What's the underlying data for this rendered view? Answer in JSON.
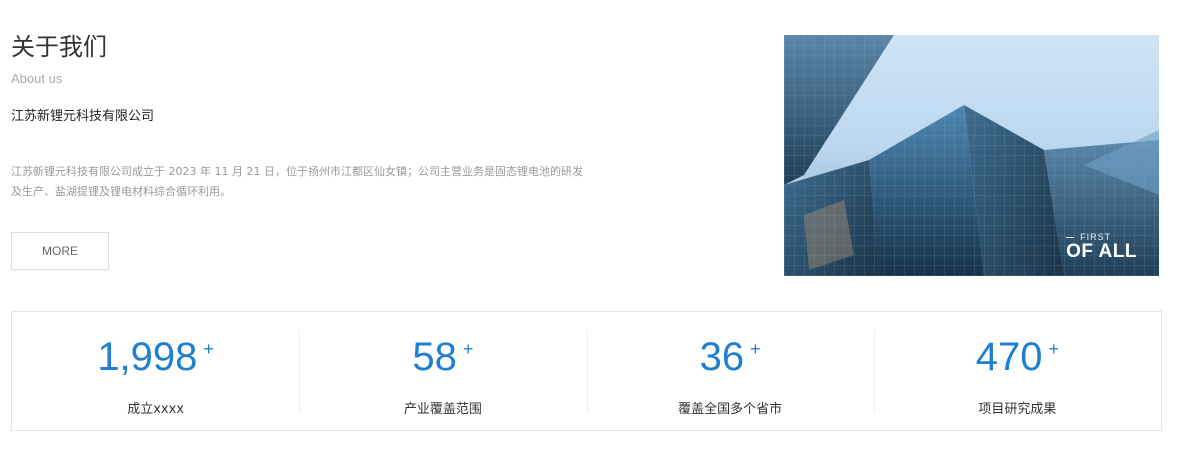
{
  "about": {
    "title": "关于我们",
    "subtitle": "About us",
    "company": "江苏新锂元科技有限公司",
    "description": "江苏新锂元科技有限公司成立于 2023 年 11 月 21 日，位于扬州市江都区仙女镇；公司主营业务是固态锂电池的研发及生产、盐湖提锂及锂电材料综合循环利用。",
    "more_label": "MORE"
  },
  "hero": {
    "first": "FIRST",
    "ofall": "OF ALL"
  },
  "stats": [
    {
      "value": "1,998",
      "plus": "+",
      "label": "成立xxxx"
    },
    {
      "value": "58",
      "plus": "+",
      "label": "产业覆盖范围"
    },
    {
      "value": "36",
      "plus": "+",
      "label": "覆盖全国多个省市"
    },
    {
      "value": "470",
      "plus": "+",
      "label": "项目研究成果"
    }
  ],
  "colors": {
    "accent": "#1f7fd1"
  },
  "icons": {
    "hero_image": "skyscrapers-image"
  }
}
